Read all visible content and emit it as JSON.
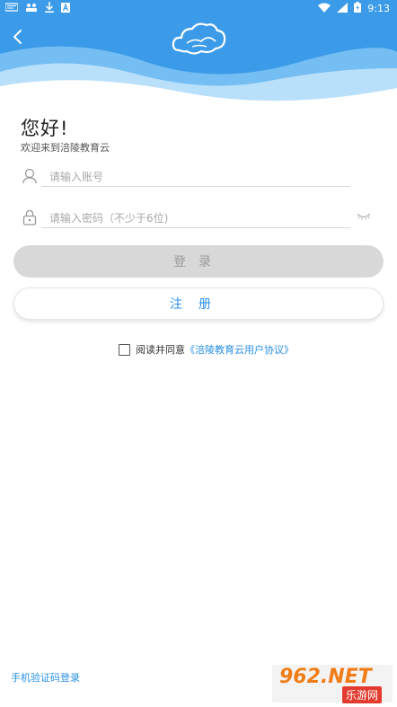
{
  "status_bar": {
    "time": "9:13"
  },
  "header": {
    "back_icon": "chevron-left-icon",
    "logo_icon": "cloud-icon"
  },
  "greeting": {
    "title": "您好!",
    "subtitle": "欢迎来到涪陵教育云"
  },
  "form": {
    "account_placeholder": "请输入账号",
    "password_placeholder": "请输入密码（不少于6位)",
    "login_label": "登录",
    "register_label": "注册"
  },
  "agreement": {
    "prefix": "阅读并同意",
    "link_text": "《涪陵教育云用户协议》",
    "checked": false
  },
  "footer": {
    "sms_login_label": "手机验证码登录"
  },
  "watermark": {
    "text": "962.NET",
    "sub": "乐游网"
  },
  "colors": {
    "header_blue": "#3c9be8",
    "link_blue": "#2a8fe6",
    "login_disabled_bg": "#d8d8d8"
  }
}
